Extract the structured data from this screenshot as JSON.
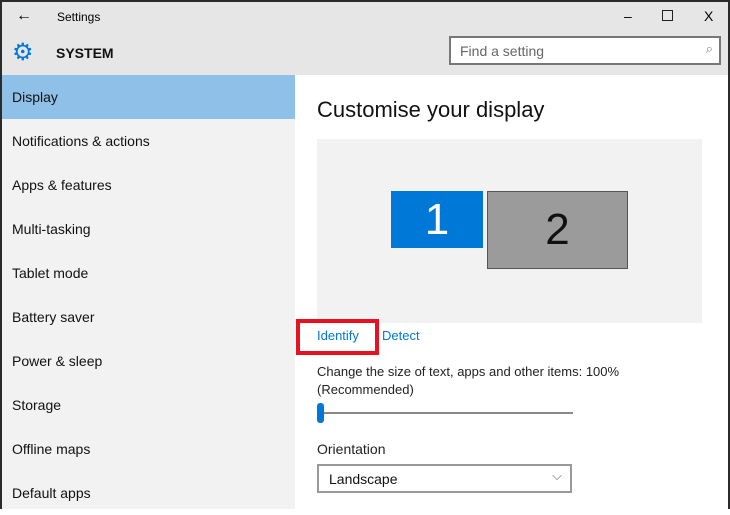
{
  "window": {
    "title": "Settings",
    "minimize": "–",
    "maximize": "☐",
    "close": "X"
  },
  "header": {
    "section": "SYSTEM",
    "search_placeholder": "Find a setting"
  },
  "sidebar": {
    "items": [
      {
        "label": "Display",
        "selected": true
      },
      {
        "label": "Notifications & actions"
      },
      {
        "label": "Apps & features"
      },
      {
        "label": "Multi-tasking"
      },
      {
        "label": "Tablet mode"
      },
      {
        "label": "Battery saver"
      },
      {
        "label": "Power & sleep"
      },
      {
        "label": "Storage"
      },
      {
        "label": "Offline maps"
      },
      {
        "label": "Default apps"
      }
    ]
  },
  "main": {
    "title": "Customise your display",
    "monitors": [
      "1",
      "2"
    ],
    "identify": "Identify",
    "detect": "Detect",
    "scale_label": "Change the size of text, apps and other items: 100%",
    "scale_note": "(Recommended)",
    "scale_slider_percent": 0,
    "orientation_label": "Orientation",
    "orientation_value": "Landscape"
  },
  "colors": {
    "accent": "#0078d7",
    "selected": "#8fc0e7",
    "highlight": "#e81123"
  }
}
